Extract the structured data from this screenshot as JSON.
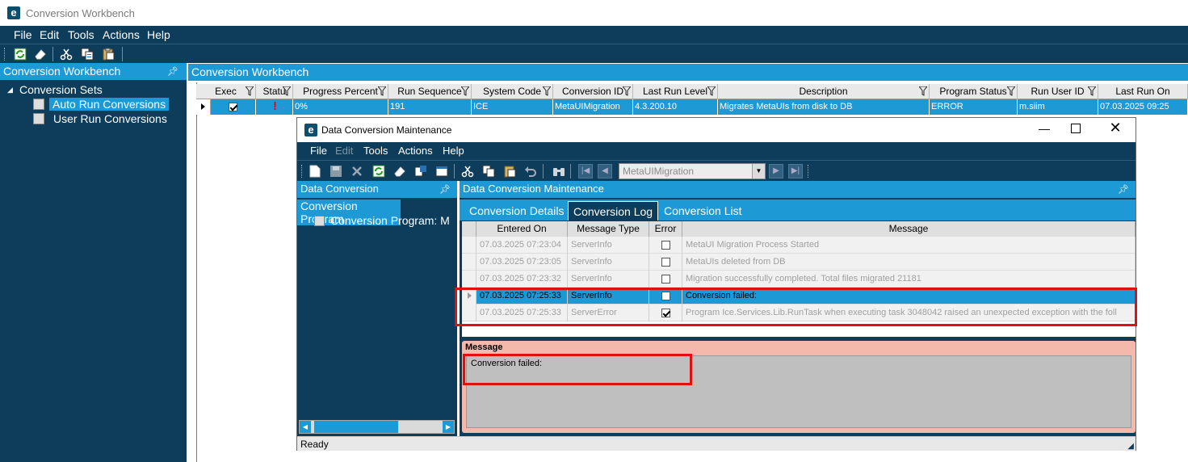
{
  "window": {
    "title": "Conversion Workbench",
    "logo_letter": "e"
  },
  "menu": [
    "File",
    "Edit",
    "Tools",
    "Actions",
    "Help"
  ],
  "toolbar_icons": [
    "refresh-icon",
    "eraser-icon",
    "cut-icon",
    "copy-icon",
    "paste-icon"
  ],
  "left_pane": {
    "title": "Conversion Workbench",
    "tree": {
      "root": "Conversion Sets",
      "items": [
        "Auto Run Conversions",
        "User Run Conversions"
      ]
    }
  },
  "main": {
    "title": "Conversion Workbench",
    "columns": [
      "Exec",
      "Statu",
      "Progress Percent",
      "Run Sequence",
      "System Code",
      "Conversion ID",
      "Last Run Level",
      "Description",
      "Program Status",
      "Run User ID",
      "Last Run On"
    ],
    "row": {
      "progress": "0%",
      "run_sequence": "191",
      "system_code": "ICE",
      "conversion_id": "MetaUIMigration",
      "last_run_level": "4.3.200.10",
      "description": "Migrates MetaUIs from disk to DB",
      "program_status": "ERROR",
      "run_user_id": "m.siim",
      "last_run_on": "07.03.2025 09:25",
      "status_icon": "!"
    }
  },
  "dialog": {
    "title": "Data Conversion Maintenance",
    "menu": [
      "File",
      "Edit",
      "Tools",
      "Actions",
      "Help"
    ],
    "combo_value": "MetaUIMigration",
    "left_pane": {
      "title": "Data Conversion",
      "selected": "Conversion Program",
      "child": "Conversion Program: M"
    },
    "right_pane": {
      "title": "Data Conversion Maintenance",
      "tabs": [
        "Conversion Details",
        "Conversion Log",
        "Conversion List"
      ]
    },
    "log_columns": [
      "Entered On",
      "Message Type",
      "Error",
      "Message"
    ],
    "log_rows": [
      {
        "entered_on": "07.03.2025 07:23:04",
        "type": "ServerInfo",
        "error": false,
        "message": "MetaUI Migration Process Started"
      },
      {
        "entered_on": "07.03.2025 07:23:05",
        "type": "ServerInfo",
        "error": false,
        "message": "MetaUIs deleted from DB"
      },
      {
        "entered_on": "07.03.2025 07:23:32",
        "type": "ServerInfo",
        "error": false,
        "message": "Migration successfully completed. Total files migrated 21181"
      },
      {
        "entered_on": "07.03.2025 07:25:33",
        "type": "ServerInfo",
        "error": false,
        "message": "Conversion failed:"
      },
      {
        "entered_on": "07.03.2025 07:25:33",
        "type": "ServerError",
        "error": true,
        "message": "Program Ice.Services.Lib.RunTask when executing task 3048042 raised an unexpected exception with the foll"
      }
    ],
    "message_panel": {
      "label": "Message",
      "text": "Conversion failed:"
    },
    "status": "Ready"
  },
  "colors": {
    "dark_navy": "#0e3d5c",
    "accent_blue": "#1d9ad6",
    "highlight_red": "#e01010"
  }
}
